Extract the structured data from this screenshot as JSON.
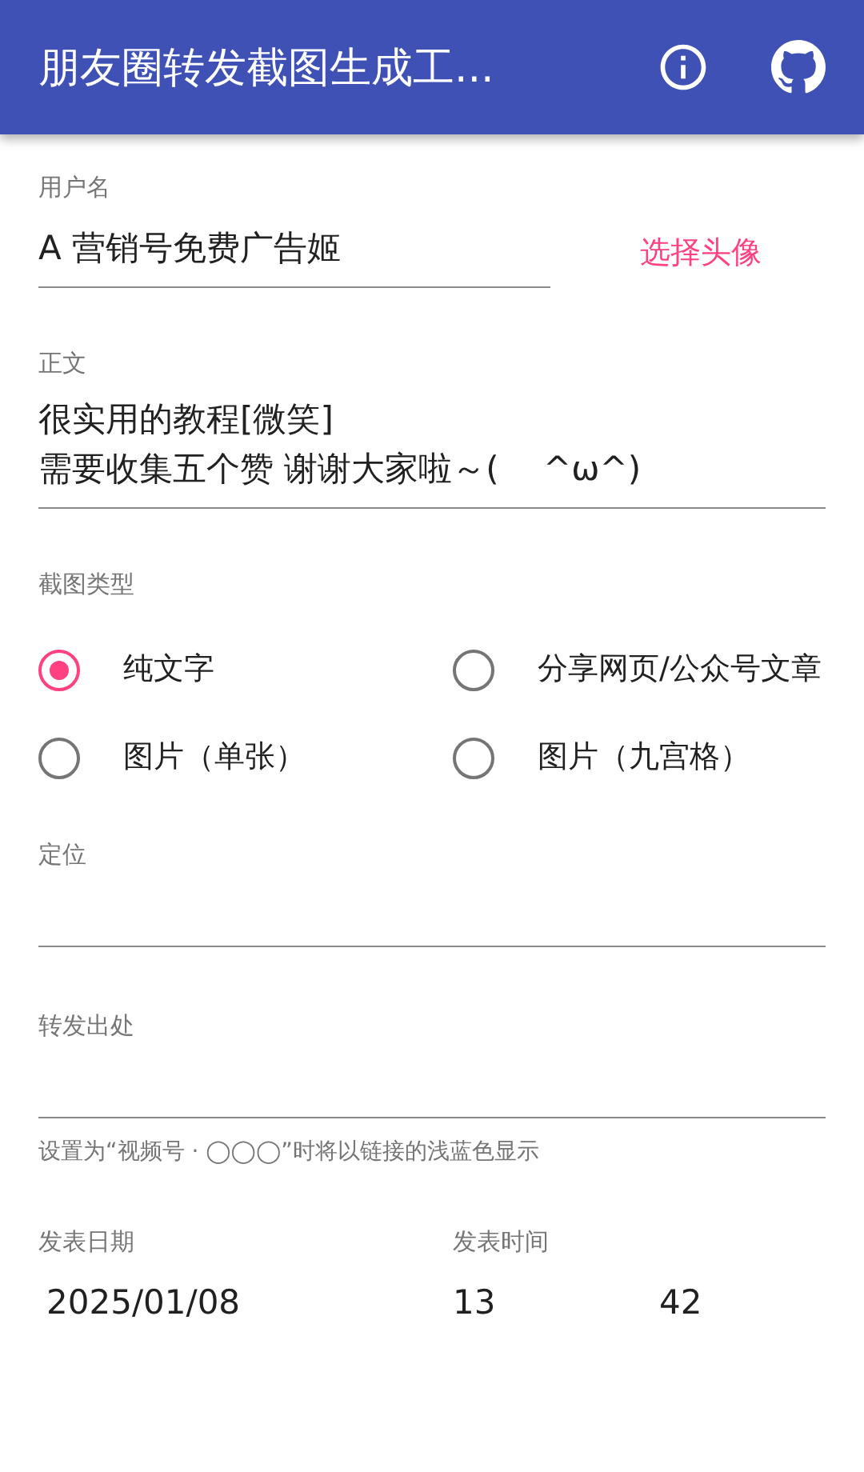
{
  "app_bar": {
    "title": "朋友圈转发截图生成工...",
    "actions": [
      {
        "kind": "info"
      },
      {
        "kind": "github"
      }
    ]
  },
  "username": {
    "label": "用户名",
    "value": "A 营销号免费广告姬",
    "action": "选择头像"
  },
  "body": {
    "label": "正文",
    "value": "很实用的教程[微笑]\n需要收集五个赞 谢谢大家啦～(　 ^ω^)"
  },
  "screenshot_type": {
    "label": "截图类型",
    "options": [
      {
        "label": "纯文字",
        "selected": true
      },
      {
        "label": "分享网页/公众号文章",
        "selected": false
      },
      {
        "label": "图片（单张）",
        "selected": false
      },
      {
        "label": "图片（九宫格）",
        "selected": false
      }
    ]
  },
  "location": {
    "label": "定位"
  },
  "source": {
    "label": "转发出处",
    "helper": "设置为“视频号 · ◯◯◯”时将以链接的浅蓝色显示"
  },
  "publish_date": {
    "label": "发表日期",
    "value": "2025/01/08"
  },
  "publish_time": {
    "label": "发表时间",
    "hour": "13",
    "minute": "42"
  }
}
